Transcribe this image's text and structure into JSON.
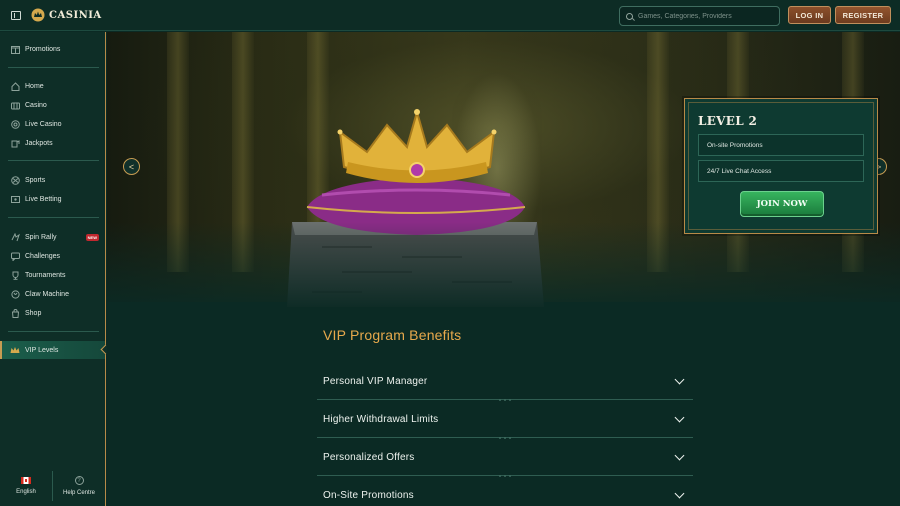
{
  "header": {
    "brand": "CASINIA",
    "search_placeholder": "Games, Categories, Providers",
    "login_label": "LOG IN",
    "register_label": "REGISTER"
  },
  "sidebar": {
    "promotions": {
      "label": "Promotions",
      "icon": "gift-icon"
    },
    "group1": [
      {
        "label": "Home",
        "icon": "home-icon"
      },
      {
        "label": "Casino",
        "icon": "casino-icon"
      },
      {
        "label": "Live Casino",
        "icon": "live-casino-icon"
      },
      {
        "label": "Jackpots",
        "icon": "jackpot-icon"
      }
    ],
    "group2": [
      {
        "label": "Sports",
        "icon": "sports-icon"
      },
      {
        "label": "Live Betting",
        "icon": "live-betting-icon"
      }
    ],
    "group3": [
      {
        "label": "Spin Rally",
        "icon": "spin-rally-icon",
        "badge": "NEW"
      },
      {
        "label": "Challenges",
        "icon": "challenges-icon"
      },
      {
        "label": "Tournaments",
        "icon": "trophy-icon"
      },
      {
        "label": "Claw Machine",
        "icon": "claw-machine-icon"
      },
      {
        "label": "Shop",
        "icon": "shop-icon"
      }
    ],
    "vip": {
      "label": "VIP Levels",
      "icon": "crown-icon"
    },
    "footer": {
      "language": "English",
      "help": "Help Centre",
      "help_icon_glyph": "?"
    }
  },
  "hero": {
    "prev_glyph": "<",
    "next_glyph": ">"
  },
  "level_card": {
    "title": "LEVEL 2",
    "benefits": [
      "On-site Promotions",
      "24/7 Live Chat Access"
    ],
    "cta": "JOIN NOW"
  },
  "benefits_section": {
    "title": "VIP Program Benefits",
    "items": [
      "Personal VIP Manager",
      "Higher Withdrawal Limits",
      "Personalized Offers",
      "On-Site Promotions"
    ]
  },
  "colors": {
    "accent_gold": "#c79c52",
    "title_orange": "#e7a94c",
    "cta_green": "#37b45e",
    "background": "#0b2a24"
  }
}
